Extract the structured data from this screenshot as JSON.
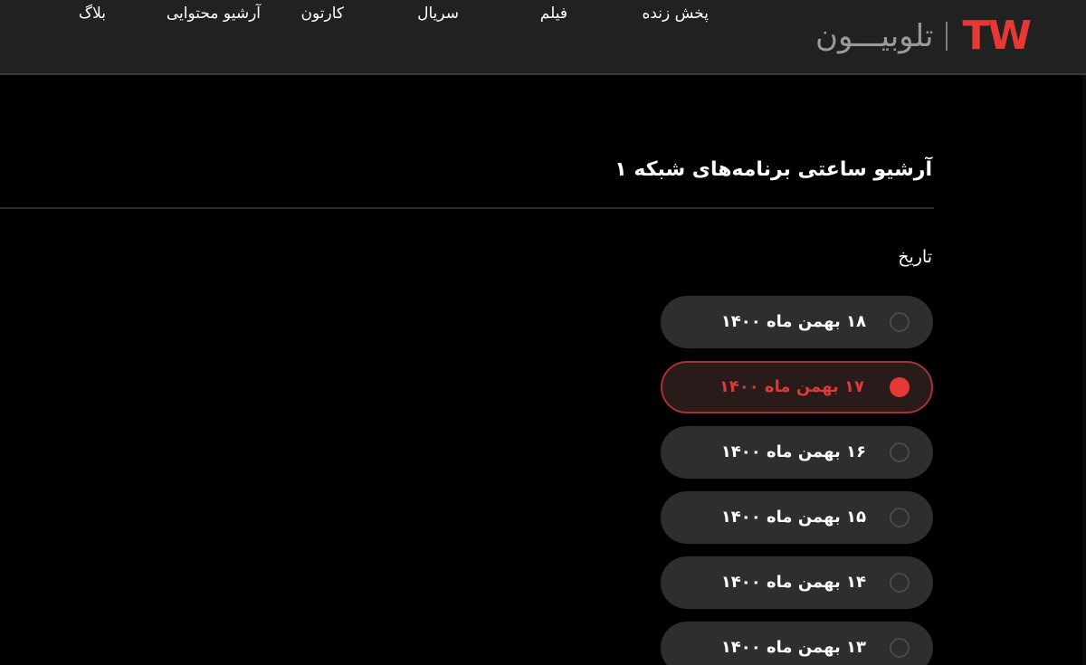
{
  "header": {
    "logo_mark": "TW",
    "logo_text": "تلوبیـــون",
    "nav": [
      {
        "label": "پخش زنده"
      },
      {
        "label": "فیلم"
      },
      {
        "label": "سریال"
      },
      {
        "label": "کارتون"
      },
      {
        "label": "آرشیو محتوایی"
      },
      {
        "label": "بلاگ"
      }
    ]
  },
  "main": {
    "title": "آرشیو ساعتی برنامه‌های شبکه ۱",
    "date_label": "تاریخ",
    "dates": [
      {
        "label": "۱۸ بهمن ماه ۱۴۰۰",
        "selected": false
      },
      {
        "label": "۱۷ بهمن ماه ۱۴۰۰",
        "selected": true
      },
      {
        "label": "۱۶ بهمن ماه ۱۴۰۰",
        "selected": false
      },
      {
        "label": "۱۵ بهمن ماه ۱۴۰۰",
        "selected": false
      },
      {
        "label": "۱۴ بهمن ماه ۱۴۰۰",
        "selected": false
      },
      {
        "label": "۱۳ بهمن ماه ۱۴۰۰",
        "selected": false
      }
    ]
  },
  "colors": {
    "accent": "#e53935",
    "header_bg": "#212121",
    "page_bg": "#000000",
    "option_bg": "#2e2e2e"
  }
}
